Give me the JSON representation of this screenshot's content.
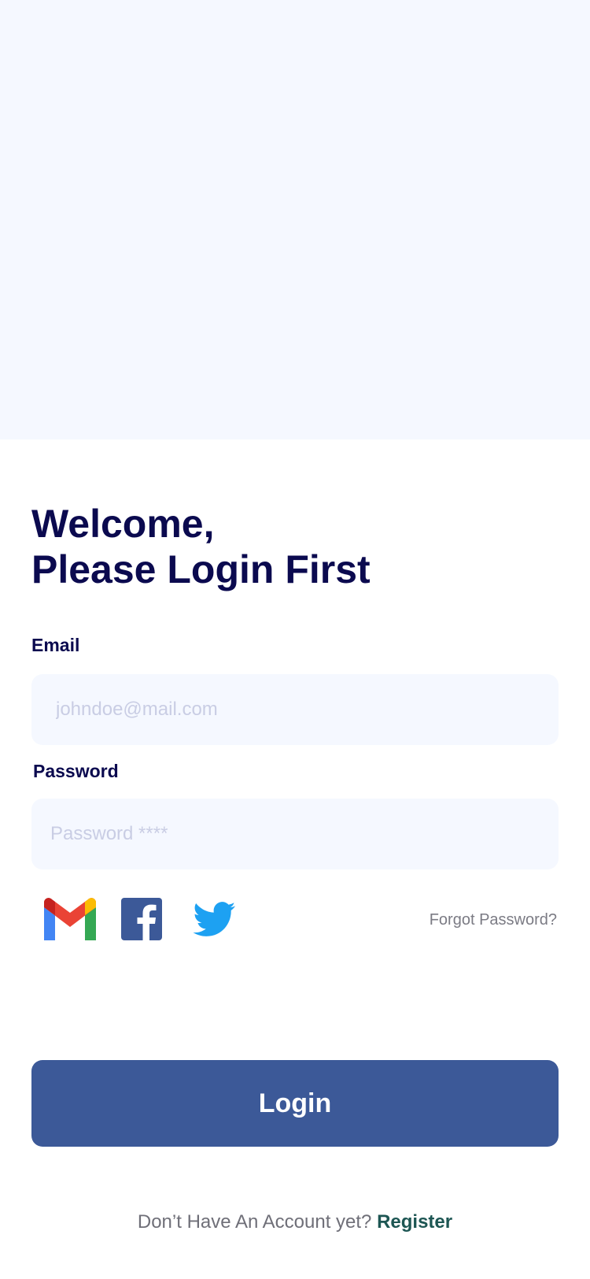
{
  "heading": {
    "line1": "Welcome,",
    "line2": "Please Login First"
  },
  "form": {
    "email_label": "Email",
    "email_placeholder": "johndoe@mail.com",
    "password_label": "Password",
    "password_placeholder": "Password ****"
  },
  "social": {
    "icons": [
      "gmail-icon",
      "facebook-icon",
      "twitter-icon"
    ]
  },
  "forgot_password": "Forgot Password?",
  "login_button": "Login",
  "footer": {
    "prompt": "Don’t Have An Account yet?",
    "register": "Register"
  },
  "colors": {
    "primary": "#3c5998",
    "heading": "#0b0a4f",
    "field_bg": "#f5f8ff",
    "register": "#1d5653"
  }
}
